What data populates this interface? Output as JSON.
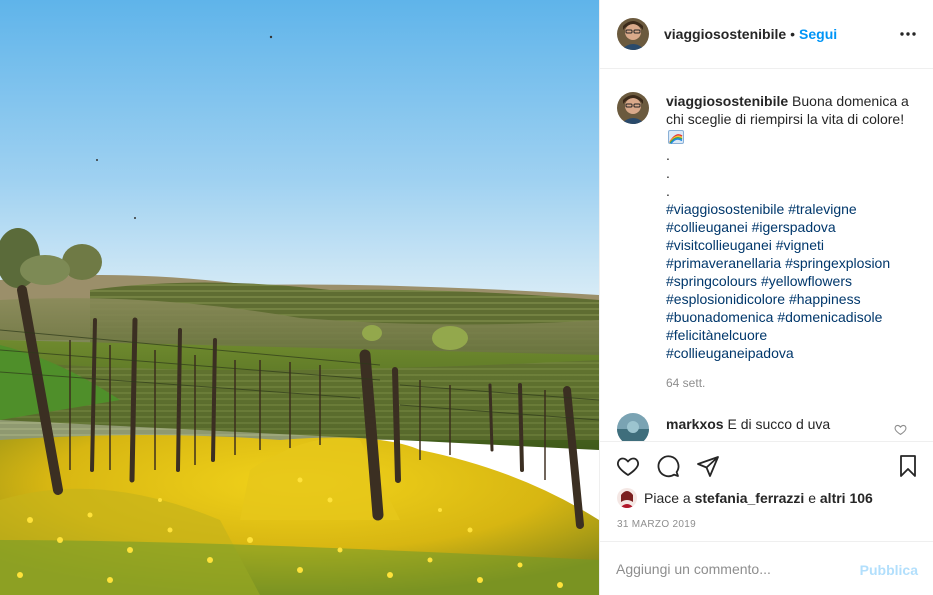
{
  "post": {
    "username": "viaggiosostenibile",
    "follow_label": "Segui",
    "separator": "•"
  },
  "caption": {
    "username": "viaggiosostenibile",
    "text": "Buona domenica a chi sceglie di riempirsi la vita di colore!",
    "emoji": "rainbow-flag-icon",
    "dots": [
      ".",
      ".",
      "."
    ],
    "hashtags": [
      [
        "#viaggiosostenibile",
        "#tralevigne"
      ],
      [
        "#collieuganei",
        "#igerspadova"
      ],
      [
        "#visitcollieuganei",
        "#vigneti"
      ],
      [
        "#primaveranellaria",
        "#springexplosion"
      ],
      [
        "#springcolours",
        "#yellowflowers"
      ],
      [
        "#esplosionidicolore",
        "#happiness"
      ],
      [
        "#buonadomenica",
        "#domenicadisole"
      ],
      [
        "#felicitànelcuore"
      ],
      [
        "#collieuganeipadova"
      ]
    ],
    "time": "64 sett."
  },
  "comment": {
    "username": "markxos",
    "text": "E di succo d uva"
  },
  "likes": {
    "prefix": "Piace a",
    "user": "stefania_ferrazzi",
    "conjunction": "e",
    "others": "altri 106"
  },
  "date": "31 MARZO 2019",
  "add_comment": {
    "placeholder": "Aggiungi un commento...",
    "publish_label": "Pubblica"
  },
  "colors": {
    "link_blue": "#0095f6",
    "hashtag_blue": "#00376b",
    "publish_disabled": "#b2dffc",
    "muted_gray": "#8e8e8e"
  }
}
